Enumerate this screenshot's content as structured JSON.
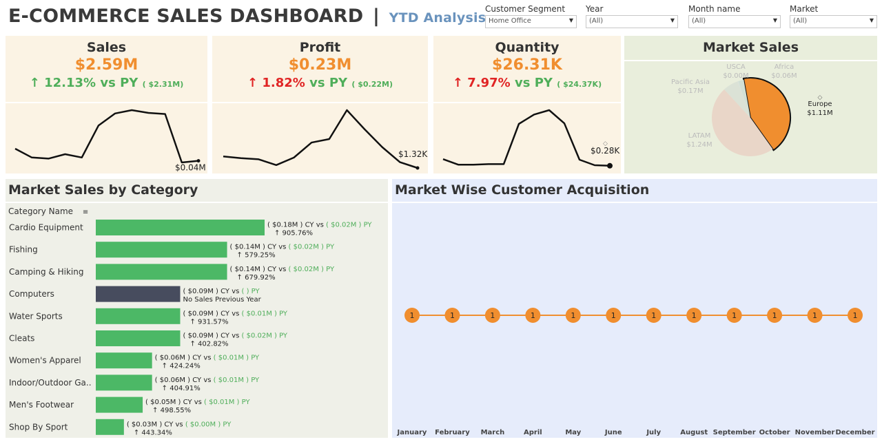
{
  "header": {
    "title": "E-COMMERCE SALES DASHBOARD",
    "separator": "|",
    "subtitle": "YTD Analysis"
  },
  "filters": [
    {
      "label": "Customer Segment",
      "value": "Home Office"
    },
    {
      "label": "Year",
      "value": "(All)"
    },
    {
      "label": "Month name",
      "value": "(All)"
    },
    {
      "label": "Market",
      "value": "(All)"
    }
  ],
  "kpis": {
    "sales": {
      "name": "Sales",
      "value": "$2.59M",
      "arrow": "↑",
      "change": "12.13%",
      "vs": "vs PY",
      "prev": "( $2.31M)",
      "direction": "green",
      "end_label": "$0.04M"
    },
    "profit": {
      "name": "Profit",
      "value": "$0.23M",
      "arrow": "↑",
      "change": "1.82%",
      "vs": "vs PY",
      "prev": "( $0.22M)",
      "direction": "red",
      "end_label": "$1.32K"
    },
    "quantity": {
      "name": "Quantity",
      "value": "$26.31K",
      "arrow": "↑",
      "change": "7.97%",
      "vs": "vs PY",
      "prev": "( $24.37K)",
      "direction": "red",
      "end_label": "$0.28K"
    }
  },
  "colors": {
    "accent": "#f08e2f",
    "green": "#4fae5a",
    "red": "#e02424",
    "bar_green": "#4cb866",
    "bar_dark": "#474c5e",
    "title_blue": "#6a93bd"
  },
  "chart_data": [
    {
      "type": "line",
      "id": "sales_trend",
      "x": [
        1,
        2,
        3,
        4,
        5,
        6,
        7,
        8,
        9,
        10,
        11,
        12
      ],
      "values": [
        0.3,
        0.14,
        0.12,
        0.2,
        0.14,
        0.72,
        0.94,
        1.0,
        0.95,
        0.93,
        0.05,
        0.08
      ],
      "end_label": "$0.04M"
    },
    {
      "type": "line",
      "id": "profit_trend",
      "x": [
        1,
        2,
        3,
        4,
        5,
        6,
        7,
        8,
        9,
        10,
        11,
        12
      ],
      "values": [
        0.2,
        0.17,
        0.15,
        0.05,
        0.18,
        0.44,
        0.5,
        1.0,
        0.67,
        0.36,
        0.1,
        0.0
      ],
      "end_label": "$1.32K"
    },
    {
      "type": "line",
      "id": "quantity_trend",
      "x": [
        1,
        2,
        3,
        4,
        5,
        6,
        7,
        8,
        9,
        10,
        11,
        12
      ],
      "values": [
        0.11,
        0.01,
        0.01,
        0.02,
        0.02,
        0.75,
        0.92,
        1.0,
        0.76,
        0.1,
        0.0,
        -0.01
      ],
      "end_label": "$0.28K"
    },
    {
      "type": "pie",
      "id": "market_sales",
      "title": "Market Sales",
      "slices": [
        {
          "label": "Europe",
          "value_label": "$1.11M",
          "value": 1.11,
          "color": "#f08e2f",
          "highlight": true
        },
        {
          "label": "LATAM",
          "value_label": "$1.24M",
          "value": 1.24,
          "color": "#e9d6c8",
          "highlight": false
        },
        {
          "label": "Pacific Asia",
          "value_label": "$0.17M",
          "value": 0.17,
          "color": "#dbe2d6",
          "highlight": false
        },
        {
          "label": "USCA",
          "value_label": "$0.00M",
          "value": 0.005,
          "color": "#d9e1e2",
          "highlight": false
        },
        {
          "label": "Africa",
          "value_label": "$0.06M",
          "value": 0.06,
          "color": "#d2e0d5",
          "highlight": false
        }
      ]
    },
    {
      "type": "bar",
      "id": "market_sales_by_category",
      "title": "Market Sales by Category",
      "column_header": "Category Name",
      "categories": [
        "Cardio Equipment",
        "Fishing",
        "Camping & Hiking",
        "Computers",
        "Water Sports",
        "Cleats",
        "Women's Apparel",
        "Indoor/Outdoor Ga..",
        "Men's Footwear",
        "Shop By Sport"
      ],
      "values": [
        0.18,
        0.14,
        0.14,
        0.09,
        0.09,
        0.09,
        0.06,
        0.06,
        0.05,
        0.03
      ],
      "cy_labels": [
        "( $0.18M ) CY vs",
        "( $0.14M ) CY vs",
        "( $0.14M ) CY vs",
        "( $0.09M ) CY vs",
        "( $0.09M ) CY vs",
        "( $0.09M ) CY vs",
        "( $0.06M ) CY vs",
        "( $0.06M ) CY vs",
        "( $0.05M ) CY vs",
        "( $0.03M ) CY vs"
      ],
      "py_labels": [
        "( $0.02M ) PY",
        "( $0.02M ) PY",
        "( $0.02M ) PY",
        "( ) PY",
        "( $0.01M ) PY",
        "( $0.02M ) PY",
        "( $0.01M ) PY",
        "( $0.01M ) PY",
        "( $0.01M ) PY",
        "( $0.00M ) PY"
      ],
      "growth_labels": [
        "↑ 905.76%",
        "↑ 579.25%",
        "↑ 679.92%",
        "No Sales Previous Year",
        "↑ 931.57%",
        "↑ 402.82%",
        "↑ 424.24%",
        "↑ 404.91%",
        "↑ 498.55%",
        "↑ 443.34%"
      ],
      "no_prev": [
        false,
        false,
        false,
        true,
        false,
        false,
        false,
        false,
        false,
        false
      ]
    },
    {
      "type": "line",
      "id": "customer_acquisition",
      "title": "Market Wise Customer Acquisition",
      "categories": [
        "January",
        "February",
        "March",
        "April",
        "May",
        "June",
        "July",
        "August",
        "September",
        "October",
        "November",
        "December"
      ],
      "values": [
        1,
        1,
        1,
        1,
        1,
        1,
        1,
        1,
        1,
        1,
        1,
        1
      ]
    }
  ]
}
